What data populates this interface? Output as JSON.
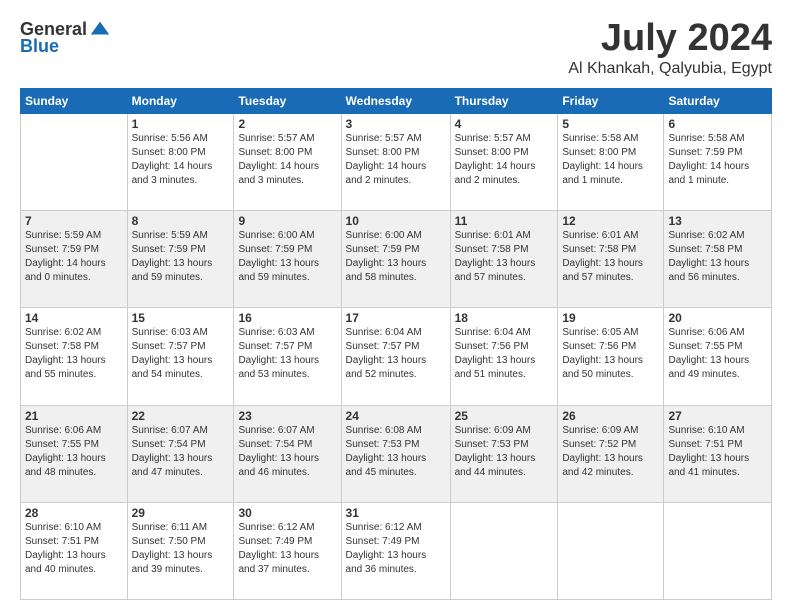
{
  "logo": {
    "general": "General",
    "blue": "Blue"
  },
  "header": {
    "month": "July 2024",
    "location": "Al Khankah, Qalyubia, Egypt"
  },
  "weekdays": [
    "Sunday",
    "Monday",
    "Tuesday",
    "Wednesday",
    "Thursday",
    "Friday",
    "Saturday"
  ],
  "weeks": [
    [
      {
        "day": "",
        "info": ""
      },
      {
        "day": "1",
        "info": "Sunrise: 5:56 AM\nSunset: 8:00 PM\nDaylight: 14 hours\nand 3 minutes."
      },
      {
        "day": "2",
        "info": "Sunrise: 5:57 AM\nSunset: 8:00 PM\nDaylight: 14 hours\nand 3 minutes."
      },
      {
        "day": "3",
        "info": "Sunrise: 5:57 AM\nSunset: 8:00 PM\nDaylight: 14 hours\nand 2 minutes."
      },
      {
        "day": "4",
        "info": "Sunrise: 5:57 AM\nSunset: 8:00 PM\nDaylight: 14 hours\nand 2 minutes."
      },
      {
        "day": "5",
        "info": "Sunrise: 5:58 AM\nSunset: 8:00 PM\nDaylight: 14 hours\nand 1 minute."
      },
      {
        "day": "6",
        "info": "Sunrise: 5:58 AM\nSunset: 7:59 PM\nDaylight: 14 hours\nand 1 minute."
      }
    ],
    [
      {
        "day": "7",
        "info": "Sunrise: 5:59 AM\nSunset: 7:59 PM\nDaylight: 14 hours\nand 0 minutes."
      },
      {
        "day": "8",
        "info": "Sunrise: 5:59 AM\nSunset: 7:59 PM\nDaylight: 13 hours\nand 59 minutes."
      },
      {
        "day": "9",
        "info": "Sunrise: 6:00 AM\nSunset: 7:59 PM\nDaylight: 13 hours\nand 59 minutes."
      },
      {
        "day": "10",
        "info": "Sunrise: 6:00 AM\nSunset: 7:59 PM\nDaylight: 13 hours\nand 58 minutes."
      },
      {
        "day": "11",
        "info": "Sunrise: 6:01 AM\nSunset: 7:58 PM\nDaylight: 13 hours\nand 57 minutes."
      },
      {
        "day": "12",
        "info": "Sunrise: 6:01 AM\nSunset: 7:58 PM\nDaylight: 13 hours\nand 57 minutes."
      },
      {
        "day": "13",
        "info": "Sunrise: 6:02 AM\nSunset: 7:58 PM\nDaylight: 13 hours\nand 56 minutes."
      }
    ],
    [
      {
        "day": "14",
        "info": "Sunrise: 6:02 AM\nSunset: 7:58 PM\nDaylight: 13 hours\nand 55 minutes."
      },
      {
        "day": "15",
        "info": "Sunrise: 6:03 AM\nSunset: 7:57 PM\nDaylight: 13 hours\nand 54 minutes."
      },
      {
        "day": "16",
        "info": "Sunrise: 6:03 AM\nSunset: 7:57 PM\nDaylight: 13 hours\nand 53 minutes."
      },
      {
        "day": "17",
        "info": "Sunrise: 6:04 AM\nSunset: 7:57 PM\nDaylight: 13 hours\nand 52 minutes."
      },
      {
        "day": "18",
        "info": "Sunrise: 6:04 AM\nSunset: 7:56 PM\nDaylight: 13 hours\nand 51 minutes."
      },
      {
        "day": "19",
        "info": "Sunrise: 6:05 AM\nSunset: 7:56 PM\nDaylight: 13 hours\nand 50 minutes."
      },
      {
        "day": "20",
        "info": "Sunrise: 6:06 AM\nSunset: 7:55 PM\nDaylight: 13 hours\nand 49 minutes."
      }
    ],
    [
      {
        "day": "21",
        "info": "Sunrise: 6:06 AM\nSunset: 7:55 PM\nDaylight: 13 hours\nand 48 minutes."
      },
      {
        "day": "22",
        "info": "Sunrise: 6:07 AM\nSunset: 7:54 PM\nDaylight: 13 hours\nand 47 minutes."
      },
      {
        "day": "23",
        "info": "Sunrise: 6:07 AM\nSunset: 7:54 PM\nDaylight: 13 hours\nand 46 minutes."
      },
      {
        "day": "24",
        "info": "Sunrise: 6:08 AM\nSunset: 7:53 PM\nDaylight: 13 hours\nand 45 minutes."
      },
      {
        "day": "25",
        "info": "Sunrise: 6:09 AM\nSunset: 7:53 PM\nDaylight: 13 hours\nand 44 minutes."
      },
      {
        "day": "26",
        "info": "Sunrise: 6:09 AM\nSunset: 7:52 PM\nDaylight: 13 hours\nand 42 minutes."
      },
      {
        "day": "27",
        "info": "Sunrise: 6:10 AM\nSunset: 7:51 PM\nDaylight: 13 hours\nand 41 minutes."
      }
    ],
    [
      {
        "day": "28",
        "info": "Sunrise: 6:10 AM\nSunset: 7:51 PM\nDaylight: 13 hours\nand 40 minutes."
      },
      {
        "day": "29",
        "info": "Sunrise: 6:11 AM\nSunset: 7:50 PM\nDaylight: 13 hours\nand 39 minutes."
      },
      {
        "day": "30",
        "info": "Sunrise: 6:12 AM\nSunset: 7:49 PM\nDaylight: 13 hours\nand 37 minutes."
      },
      {
        "day": "31",
        "info": "Sunrise: 6:12 AM\nSunset: 7:49 PM\nDaylight: 13 hours\nand 36 minutes."
      },
      {
        "day": "",
        "info": ""
      },
      {
        "day": "",
        "info": ""
      },
      {
        "day": "",
        "info": ""
      }
    ]
  ]
}
